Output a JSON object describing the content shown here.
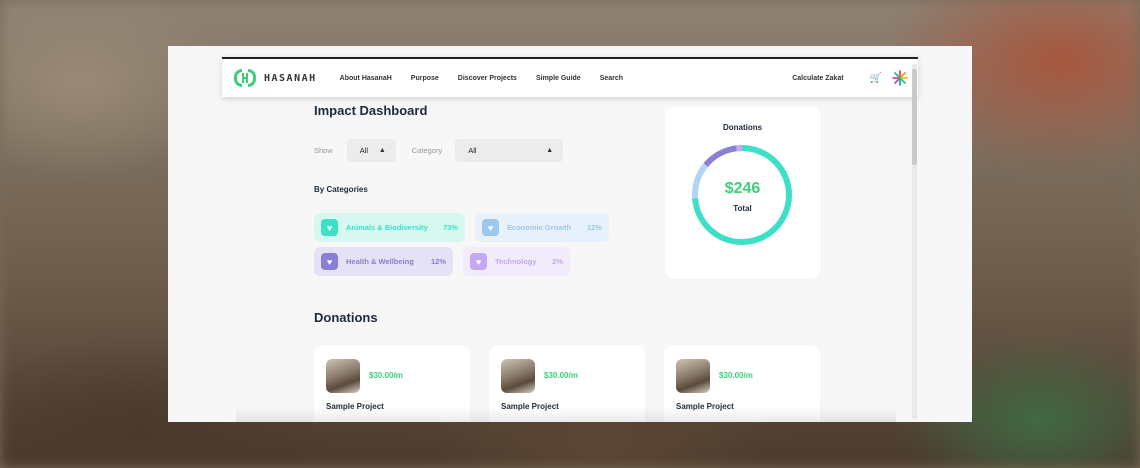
{
  "nav": {
    "brand": "HASANAH",
    "links": [
      "About HasanaH",
      "Purpose",
      "Discover Projects",
      "Simple Guide",
      "Search"
    ],
    "calculate": "Calculate Zakat",
    "icons": [
      "cart-icon",
      "burst-logo-icon"
    ]
  },
  "dashboard": {
    "title": "Impact Dashboard",
    "show_label": "Show",
    "show_value": "All",
    "category_label": "Category",
    "category_value": "All",
    "by_categories": "By Categories",
    "categories": [
      {
        "name": "Animals & Biodiversity",
        "pct": "73%",
        "color": "#3de0c7",
        "bg": "#d6f8f1"
      },
      {
        "name": "Economic Growth",
        "pct": "12%",
        "color": "#9cc8f0",
        "bg": "#e6f1fb"
      },
      {
        "name": "Health & Wellbeing",
        "pct": "12%",
        "color": "#8a7fd6",
        "bg": "#e5e2f6"
      },
      {
        "name": "Technology",
        "pct": "2%",
        "color": "#c4a8f2",
        "bg": "#f1ebfc"
      }
    ]
  },
  "donut": {
    "title": "Donations",
    "amount": "$246",
    "label": "Total",
    "segments": [
      {
        "value": 73,
        "color": "#3de0c7"
      },
      {
        "value": 12,
        "color": "#b3d4f5"
      },
      {
        "value": 12,
        "color": "#8a7fd6"
      },
      {
        "value": 2,
        "color": "#c4a8f2"
      }
    ]
  },
  "donations": {
    "title": "Donations",
    "cards": [
      {
        "amount": "$30.00/m",
        "name": "Sample Project"
      },
      {
        "amount": "$30.00/m",
        "name": "Sample Project"
      },
      {
        "amount": "$30.00/m",
        "name": "Sample Project"
      }
    ]
  }
}
